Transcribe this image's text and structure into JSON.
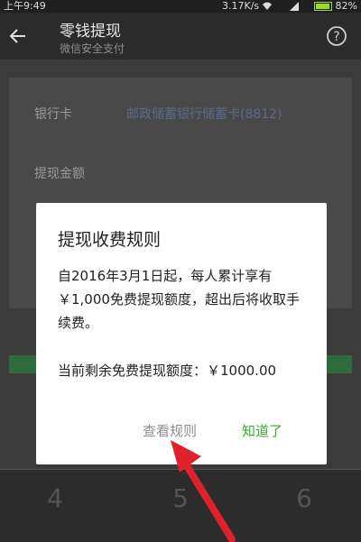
{
  "status_bar": {
    "time": "上午9:49",
    "network": "3.17K/s",
    "battery": "82%"
  },
  "header": {
    "title": "零钱提现",
    "subtitle": "微信安全支付"
  },
  "form": {
    "bank_label": "银行卡",
    "bank_value": "邮政储蓄银行储蓄卡(8812)",
    "amount_label": "提现金额"
  },
  "keypad": {
    "keys": [
      "4",
      "5",
      "6"
    ]
  },
  "dialog": {
    "title": "提现收费规则",
    "body_1": "自2016年3月1日起，每人累计享有￥1,000免费提现额度，超出后将收取手续费。",
    "body_2": "当前剩余免费提现额度：￥1000.00",
    "button_rules": "查看规则",
    "button_ok": "知道了"
  },
  "colors": {
    "accent_green": "#3aaa35",
    "annotation_red": "#e0202a"
  }
}
